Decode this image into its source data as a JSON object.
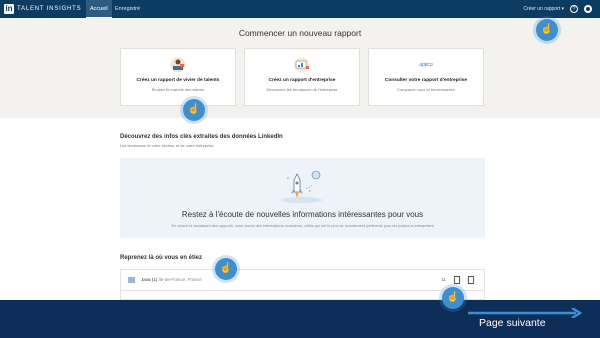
{
  "topbar": {
    "logo_mark": "in",
    "brand": "TALENT INSIGHTS",
    "tabs": [
      {
        "label": "Accueil"
      },
      {
        "label": "Enregistré"
      }
    ],
    "create_report": "Créer un rapport ▾"
  },
  "hero": {
    "title": "Commencer un nouveau rapport",
    "cards": [
      {
        "title": "Créez un rapport de vivier de talents",
        "sub": "Étudiez le marché des talents"
      },
      {
        "title": "Créez un rapport d'entreprise",
        "sub": "Découvrez les tendances de l'entreprise"
      },
      {
        "title": "Consulter votre rapport d'entreprise",
        "sub": "Comparez-vous et benchmarkez",
        "brand": "uptico"
      }
    ]
  },
  "insights": {
    "title": "Découvrez des infos clés extraites des données LinkedIn",
    "subtitle": "Les tendances et votre secteur et de votre entreprise",
    "banner_title": "Restez à l'écoute de nouvelles informations intéressantes pour vous",
    "banner_text": "En créant et visualisant des rapports, vous verrez des informations exclusives, celles qui ont le plus de recrutement pertinents pour les postes et entreprises"
  },
  "recent": {
    "title": "Reprenez là où vous en étiez",
    "item_name": "Java (1)",
    "item_location": "Île-de-France, France",
    "item_count": "11"
  },
  "footer": {
    "next_label": "Page suivante"
  },
  "tap_icon": "hand-pointer-icon",
  "colors": {
    "topbar": "#0c3c61",
    "footer": "#0c2e58",
    "accent": "#3d8fd1"
  }
}
